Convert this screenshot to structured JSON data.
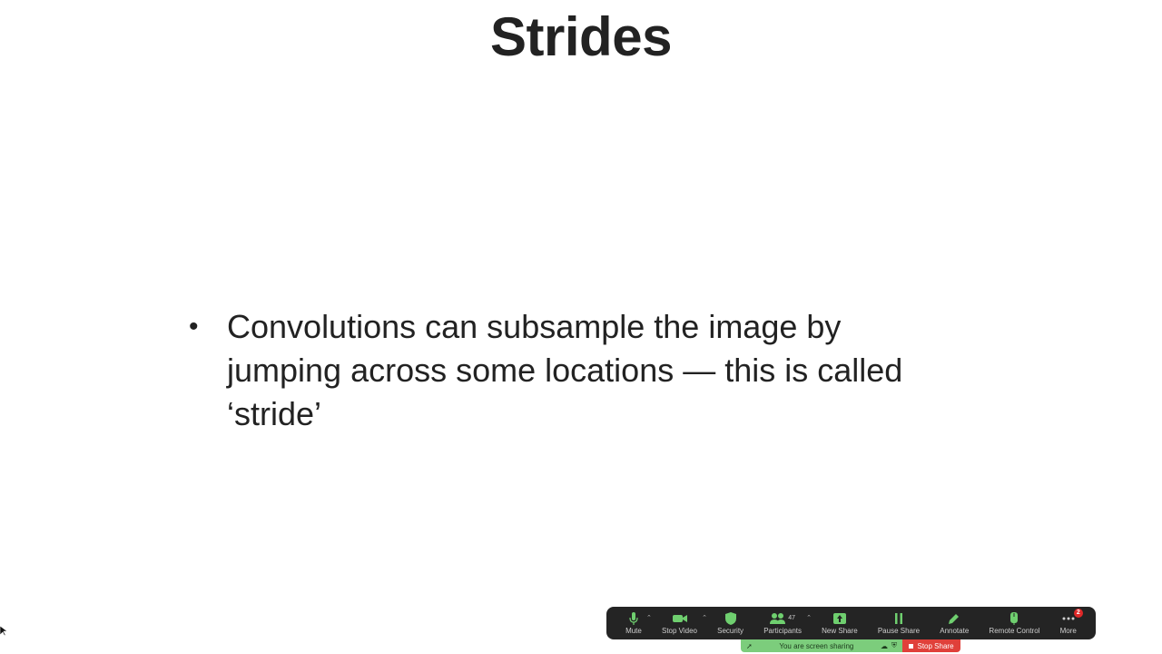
{
  "slide": {
    "title": "Strides",
    "bullets": [
      "Convolutions can subsample the image by jumping across some locations — this is called ‘stride’"
    ],
    "bullet_glyph": "•"
  },
  "toolbar": {
    "buttons": [
      {
        "label": "Mute",
        "icon": "microphone-icon",
        "has_caret": true
      },
      {
        "label": "Stop Video",
        "icon": "video-camera-icon",
        "has_caret": true
      },
      {
        "label": "Security",
        "icon": "shield-icon",
        "has_caret": false
      },
      {
        "label": "Participants",
        "icon": "participants-icon",
        "count": "47",
        "has_caret": true
      },
      {
        "label": "New Share",
        "icon": "share-up-icon",
        "has_caret": false
      },
      {
        "label": "Pause Share",
        "icon": "pause-icon",
        "has_caret": false
      },
      {
        "label": "Annotate",
        "icon": "pencil-icon",
        "has_caret": false
      },
      {
        "label": "Remote Control",
        "icon": "remote-control-icon",
        "has_caret": false
      },
      {
        "label": "More",
        "icon": "more-dots-icon",
        "badge": "2",
        "has_caret": false
      }
    ],
    "status_text": "You are screen sharing",
    "stop_share_label": "Stop Share",
    "colors": {
      "toolbar_bg": "#242424",
      "icon_green": "#6fcf6f",
      "status_bg": "#7ccd7c",
      "stop_bg": "#e0403a"
    }
  }
}
